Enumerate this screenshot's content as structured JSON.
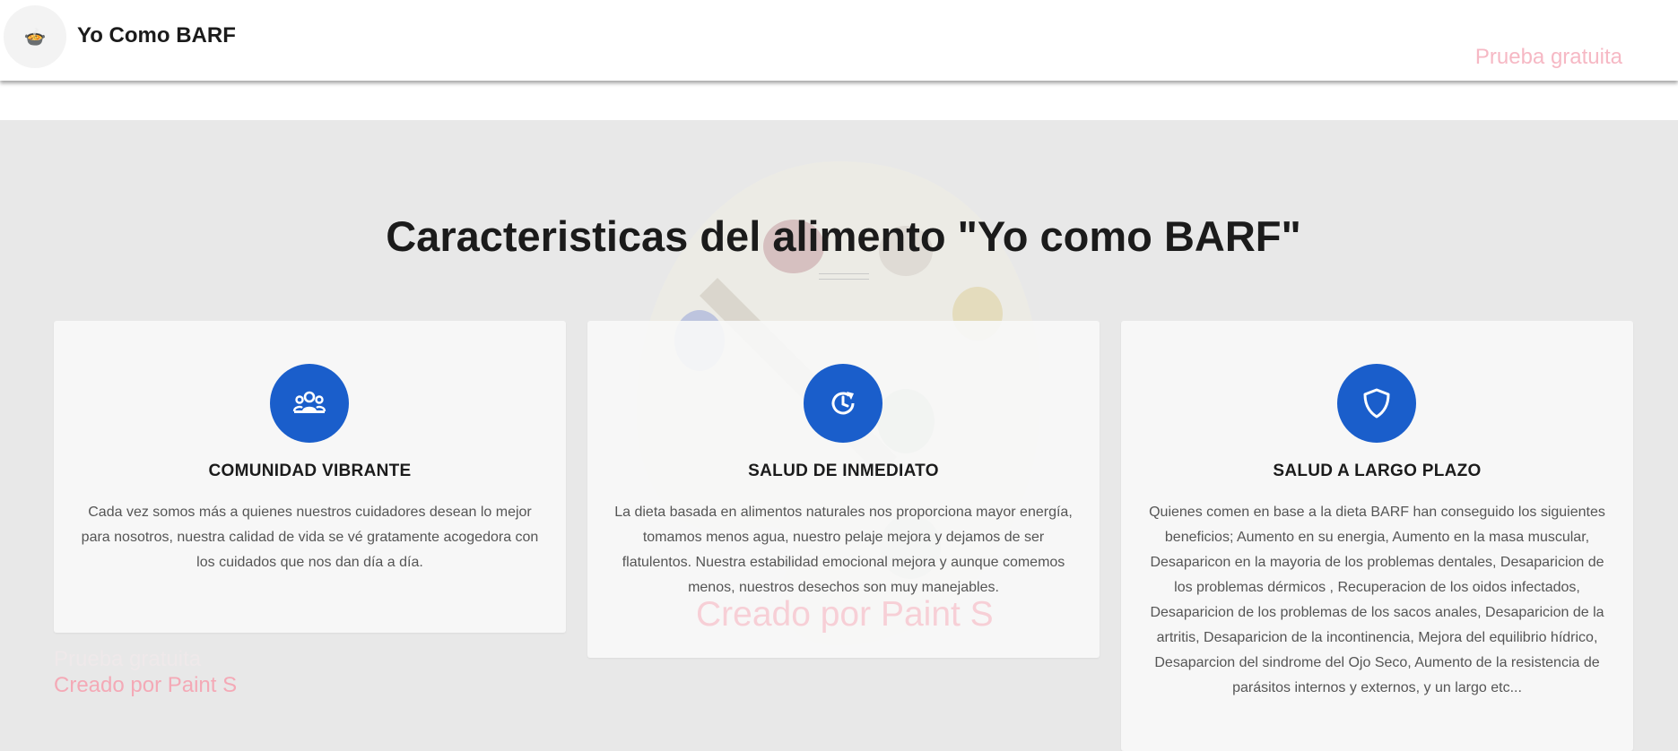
{
  "header": {
    "logo_icon": "food-bowl-icon",
    "brand": "Yo Como BARF",
    "trial_link": "Prueba gratuita"
  },
  "main": {
    "title": "Caracteristicas del alimento \"Yo como BARF\"",
    "cards": [
      {
        "icon": "community-icon",
        "title": "COMUNIDAD VIBRANTE",
        "text": "Cada vez somos más a quienes nuestros cuidadores desean lo mejor para nosotros, nuestra calidad de vida se vé gratamente acogedora con los cuidados que nos dan día a día."
      },
      {
        "icon": "refresh-clock-icon",
        "title": "SALUD DE INMEDIATO",
        "text": "La dieta basada en alimentos naturales nos proporciona mayor energía, tomamos menos agua, nuestro pelaje mejora y dejamos de ser flatulentos. Nuestra estabilidad emocional mejora y aunque comemos menos, nuestros desechos son muy manejables."
      },
      {
        "icon": "shield-icon",
        "title": "SALUD A LARGO PLAZO",
        "text": "Quienes comen en base a la dieta BARF han conseguido los siguientes beneficios; Aumento en su energia, Aumento en la masa muscular, Desaparicon en la mayoria de los problemas dentales, Desaparicion de los problemas dérmicos , Recuperacion de los oidos infectados, Desaparicion de los problemas de los sacos anales, Desaparicion de la artritis, Desaparicion de la incontinencia, Mejora del equilibrio hídrico, Desaparcion del sindrome del Ojo Seco, Aumento de la resistencia de parásitos internos y externos, y un largo etc..."
      }
    ]
  },
  "watermarks": {
    "center": "Creado por Paint S",
    "left_faint": "Prueba gratuita",
    "left": "Creado por Paint S"
  },
  "colors": {
    "accent": "#1a5ecb",
    "background": "#e8e8e8",
    "watermark": "#f4a9b6"
  }
}
